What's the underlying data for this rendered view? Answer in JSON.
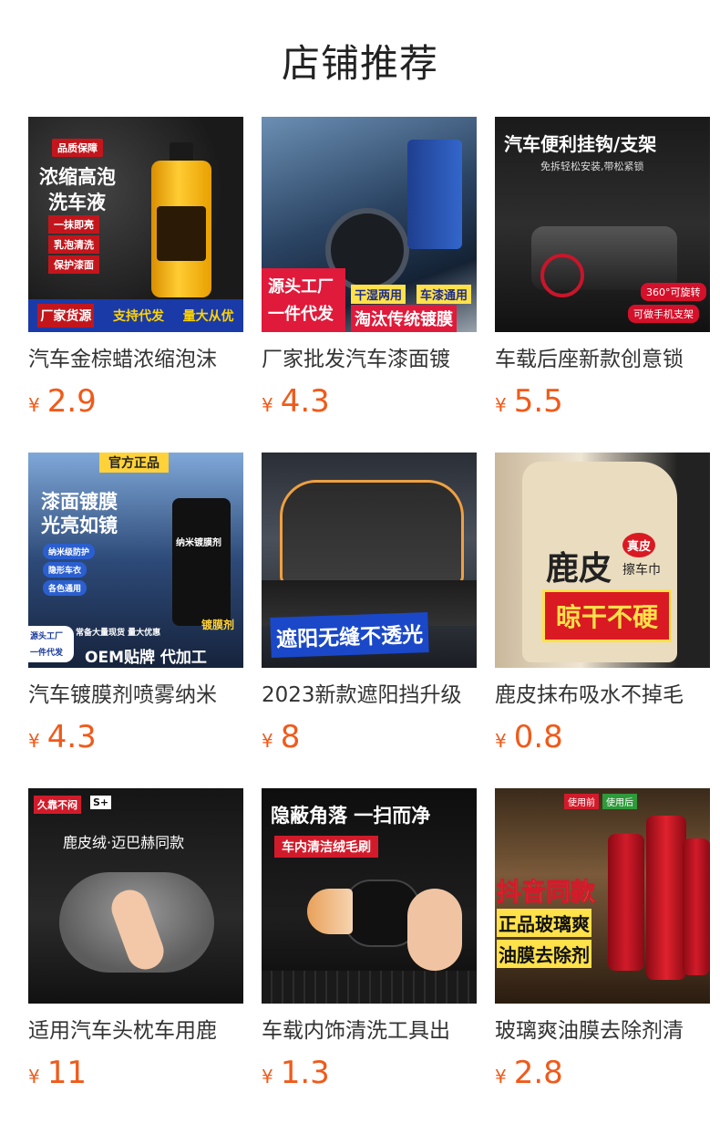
{
  "page": {
    "title": "店铺推荐"
  },
  "currency": "¥",
  "products": [
    {
      "name": "汽车金棕蜡浓缩泡沫",
      "price": "2.9",
      "overlay": {
        "badge": "品质保障",
        "headline1": "浓缩高泡",
        "headline2": "洗车液",
        "tags": [
          "一抹即亮",
          "乳泡清洗",
          "保护漆面"
        ],
        "bottom": [
          "厂家货源",
          "支持代发",
          "量大从优"
        ]
      }
    },
    {
      "name": "厂家批发汽车漆面镀",
      "price": "4.3",
      "overlay": {
        "left1": "源头工厂",
        "left2": "一件代发",
        "tag1": "干湿两用",
        "tag2": "车漆通用",
        "bottom": "淘汰传统镀膜"
      }
    },
    {
      "name": "车载后座新款创意锁",
      "price": "5.5",
      "overlay": {
        "headline": "汽车便利挂钩/支架",
        "sub": "免拆轻松安装,带松紧锁",
        "tag1": "360°可旋转",
        "tag2": "可做手机支架"
      }
    },
    {
      "name": "汽车镀膜剂喷雾纳米",
      "price": "4.3",
      "overlay": {
        "banner": "官方正品",
        "headline1": "漆面镀膜",
        "headline2": "光亮如镜",
        "tags": [
          "纳米级防护",
          "隐形车衣",
          "各色通用"
        ],
        "bottle": "纳米镀膜剂",
        "badge": "镀膜剂",
        "note": "常备大量现货 量大优惠",
        "corner1": "源头工厂",
        "corner2": "一件代发",
        "bottom": "OEM贴牌 代加工"
      }
    },
    {
      "name": "2023新款遮阳挡升级",
      "price": "8",
      "overlay": {
        "bottom": "遮阳无缝不透光"
      }
    },
    {
      "name": "鹿皮抹布吸水不掉毛",
      "price": "0.8",
      "overlay": {
        "headline": "鹿皮",
        "circle": "真皮",
        "sub": "擦车巾",
        "bottom": "晾干不硬"
      }
    },
    {
      "name": "适用汽车头枕车用鹿",
      "price": "11",
      "overlay": {
        "tag": "久靠不闷",
        "badge": "S+",
        "headline": "鹿皮绒·迈巴赫同款"
      }
    },
    {
      "name": "车载内饰清洗工具出",
      "price": "1.3",
      "overlay": {
        "headline": "隐蔽角落 一扫而净",
        "sub": "车内清洁绒毛刷"
      }
    },
    {
      "name": "玻璃爽油膜去除剂清",
      "price": "2.8",
      "overlay": {
        "before": "使用前",
        "after": "使用后",
        "headline": "抖音同款",
        "line1": "正品玻璃爽",
        "line2": "油膜去除剂"
      }
    }
  ]
}
